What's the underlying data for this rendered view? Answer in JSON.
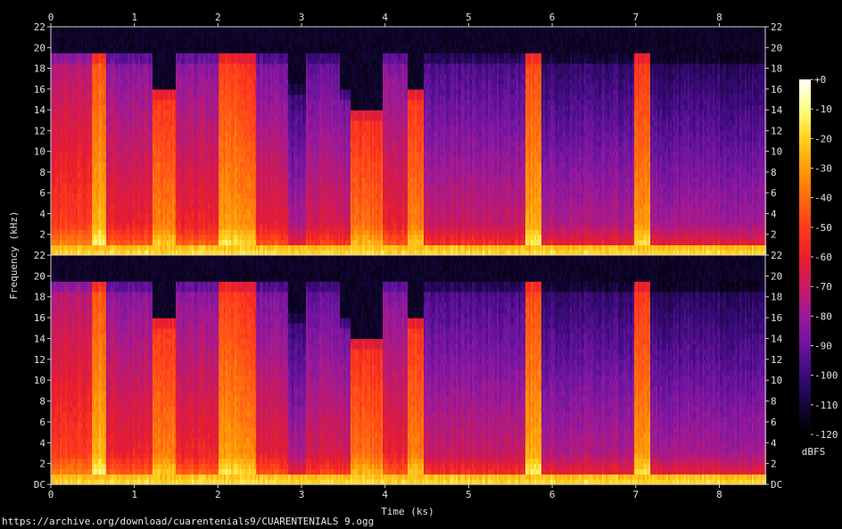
{
  "chart_data": {
    "type": "heatmap",
    "subtype": "spectrogram",
    "channels": 2,
    "xlabel": "Time (ks)",
    "ylabel": "Frequency (kHz)",
    "xlim": [
      0,
      8.55
    ],
    "ylim": [
      0,
      22
    ],
    "x_ticks": [
      "0",
      "1",
      "2",
      "3",
      "4",
      "5",
      "6",
      "7",
      "8"
    ],
    "y_ticks_top": [
      "2",
      "4",
      "6",
      "8",
      "10",
      "12",
      "14",
      "16",
      "18",
      "20",
      "22"
    ],
    "y_ticks_bottom": [
      "DC",
      "2",
      "4",
      "6",
      "8",
      "10",
      "12",
      "14",
      "16",
      "18",
      "20",
      "22"
    ],
    "colorbar": {
      "label": "dBFS",
      "range": [
        -120,
        0
      ],
      "ticks": [
        "+0",
        "-10",
        "-20",
        "-30",
        "-40",
        "-50",
        "-60",
        "-70",
        "-80",
        "-90",
        "-100",
        "-110",
        "-120"
      ],
      "colors": [
        "#000000",
        "#14063a",
        "#3a0a78",
        "#6a14a0",
        "#9a1a9a",
        "#c81a60",
        "#e81e2c",
        "#ff3c1c",
        "#ff6a10",
        "#ff9c08",
        "#ffd020",
        "#ffff80",
        "#ffffff"
      ]
    },
    "cutoff_khz": 19.5,
    "segments": [
      {
        "start": 0.0,
        "end": 0.48,
        "level": 0.62,
        "cutoff": 19.5
      },
      {
        "start": 0.48,
        "end": 0.66,
        "level": 0.82,
        "cutoff": 19.5
      },
      {
        "start": 0.66,
        "end": 1.2,
        "level": 0.55,
        "cutoff": 19.5
      },
      {
        "start": 1.2,
        "end": 1.48,
        "level": 0.74,
        "cutoff": 16.0
      },
      {
        "start": 1.48,
        "end": 2.0,
        "level": 0.55,
        "cutoff": 19.5
      },
      {
        "start": 2.0,
        "end": 2.26,
        "level": 0.78,
        "cutoff": 19.5
      },
      {
        "start": 2.26,
        "end": 2.44,
        "level": 0.74,
        "cutoff": 19.5
      },
      {
        "start": 2.44,
        "end": 2.82,
        "level": 0.52,
        "cutoff": 19.5
      },
      {
        "start": 2.82,
        "end": 3.05,
        "level": 0.4,
        "cutoff": 16.5
      },
      {
        "start": 3.05,
        "end": 3.45,
        "level": 0.5,
        "cutoff": 19.5
      },
      {
        "start": 3.45,
        "end": 3.9,
        "level": 0.48,
        "cutoff": 16.0
      },
      {
        "start": 3.58,
        "end": 3.95,
        "level": 0.7,
        "cutoff": 14.0
      },
      {
        "start": 3.95,
        "end": 4.25,
        "level": 0.55,
        "cutoff": 19.5
      },
      {
        "start": 4.25,
        "end": 4.46,
        "level": 0.74,
        "cutoff": 16.0
      },
      {
        "start": 4.46,
        "end": 5.66,
        "level": 0.46,
        "cutoff": 19.5
      },
      {
        "start": 5.66,
        "end": 5.86,
        "level": 0.8,
        "cutoff": 19.5
      },
      {
        "start": 5.86,
        "end": 6.98,
        "level": 0.42,
        "cutoff": 19.5
      },
      {
        "start": 6.98,
        "end": 7.16,
        "level": 0.78,
        "cutoff": 19.5
      },
      {
        "start": 7.16,
        "end": 8.55,
        "level": 0.4,
        "cutoff": 19.5
      }
    ]
  },
  "source_url": "https://archive.org/download/cuarentenials9/CUARENTENIALS 9.ogg"
}
